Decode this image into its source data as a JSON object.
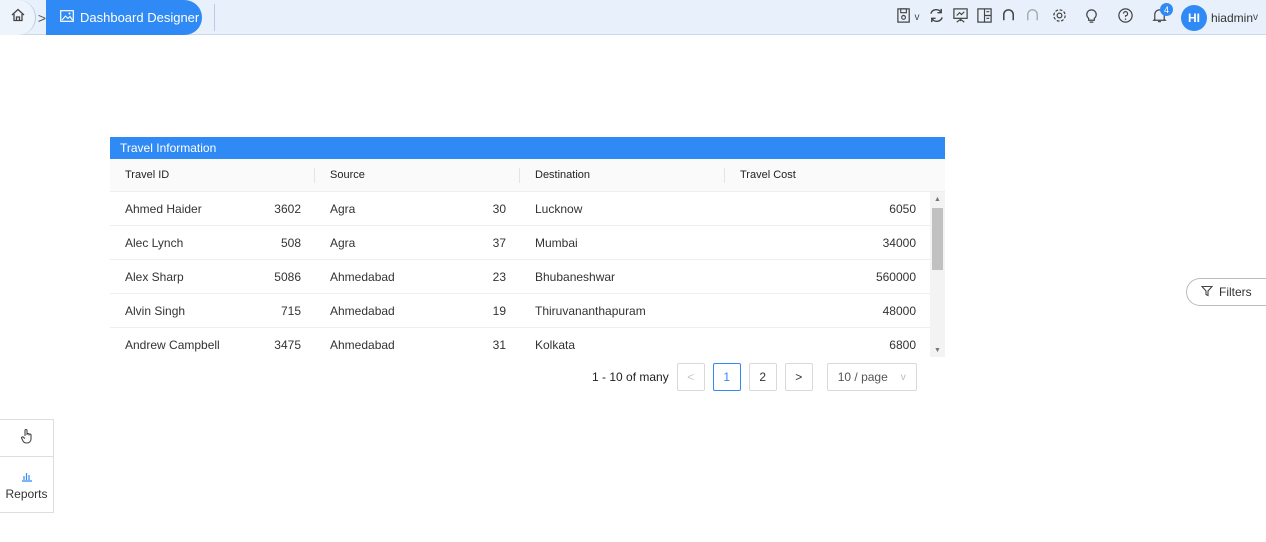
{
  "header": {
    "breadcrumb_active": "Dashboard Designer",
    "user_initials": "HI",
    "user_name": "hiadmin",
    "notification_count": "4"
  },
  "widget": {
    "title": "Travel Information",
    "columns": [
      "Travel ID",
      "Source",
      "Destination",
      "Travel Cost"
    ],
    "rows": [
      {
        "name": "Ahmed Haider",
        "id": "3602",
        "source": "Agra",
        "src_num": "30",
        "destination": "Lucknow",
        "cost": "6050"
      },
      {
        "name": "Alec Lynch",
        "id": "508",
        "source": "Agra",
        "src_num": "37",
        "destination": "Mumbai",
        "cost": "34000"
      },
      {
        "name": "Alex Sharp",
        "id": "5086",
        "source": "Ahmedabad",
        "src_num": "23",
        "destination": "Bhubaneshwar",
        "cost": "560000"
      },
      {
        "name": "Alvin Singh",
        "id": "715",
        "source": "Ahmedabad",
        "src_num": "19",
        "destination": "Thiruvananthapuram",
        "cost": "48000"
      },
      {
        "name": "Andrew Campbell",
        "id": "3475",
        "source": "Ahmedabad",
        "src_num": "31",
        "destination": "Kolkata",
        "cost": "6800"
      }
    ]
  },
  "pagination": {
    "summary": "1 - 10 of many",
    "pages": [
      "1",
      "2"
    ],
    "current_page": "1",
    "page_size": "10 / page"
  },
  "filters_label": "Filters",
  "side_panel": {
    "reports_label": "Reports"
  },
  "colors": {
    "accent": "#2f8af5",
    "topbar_bg": "#e8f1fb"
  }
}
